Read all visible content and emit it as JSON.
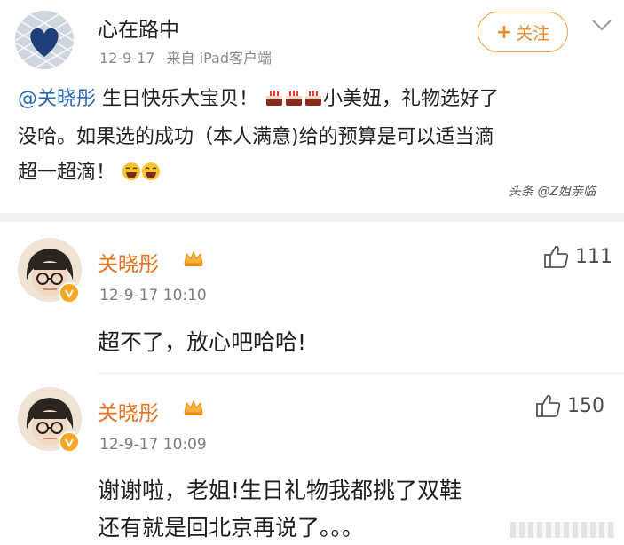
{
  "post": {
    "author_name": "心在路中",
    "date": "12-9-17",
    "source": "来自 iPad客户端",
    "follow_label": "关注",
    "follow_plus": "+",
    "mention": "@关晓彤",
    "text_part1": " 生日快乐大宝贝！",
    "text_part2": "小美妞，礼物选好了",
    "text_line2": "没哈。如果选的成功（本人满意)给的预算是可以适当滴",
    "text_line3": "超一超滴！",
    "watermark": "头条 @Z姐亲临"
  },
  "comments": [
    {
      "name": "关晓彤",
      "time": "12-9-17 10:10",
      "likes": "111",
      "text": [
        "超不了，放心吧哈哈!"
      ]
    },
    {
      "name": "关晓彤",
      "time": "12-9-17 10:09",
      "likes": "150",
      "text": [
        "谢谢啦，老姐!生日礼物我都挑了双鞋",
        "还有就是回北京再说了。。。"
      ]
    }
  ],
  "colors": {
    "accent_orange": "#e8711c",
    "mention_blue": "#2e6ab5",
    "follow_border": "#f0a24a"
  },
  "icons": [
    "heart-avatar-icon",
    "chevron-down-icon",
    "cake-emoji-icon",
    "laughing-emoji-icon",
    "crown-icon",
    "verified-badge-icon",
    "thumbs-up-icon"
  ]
}
